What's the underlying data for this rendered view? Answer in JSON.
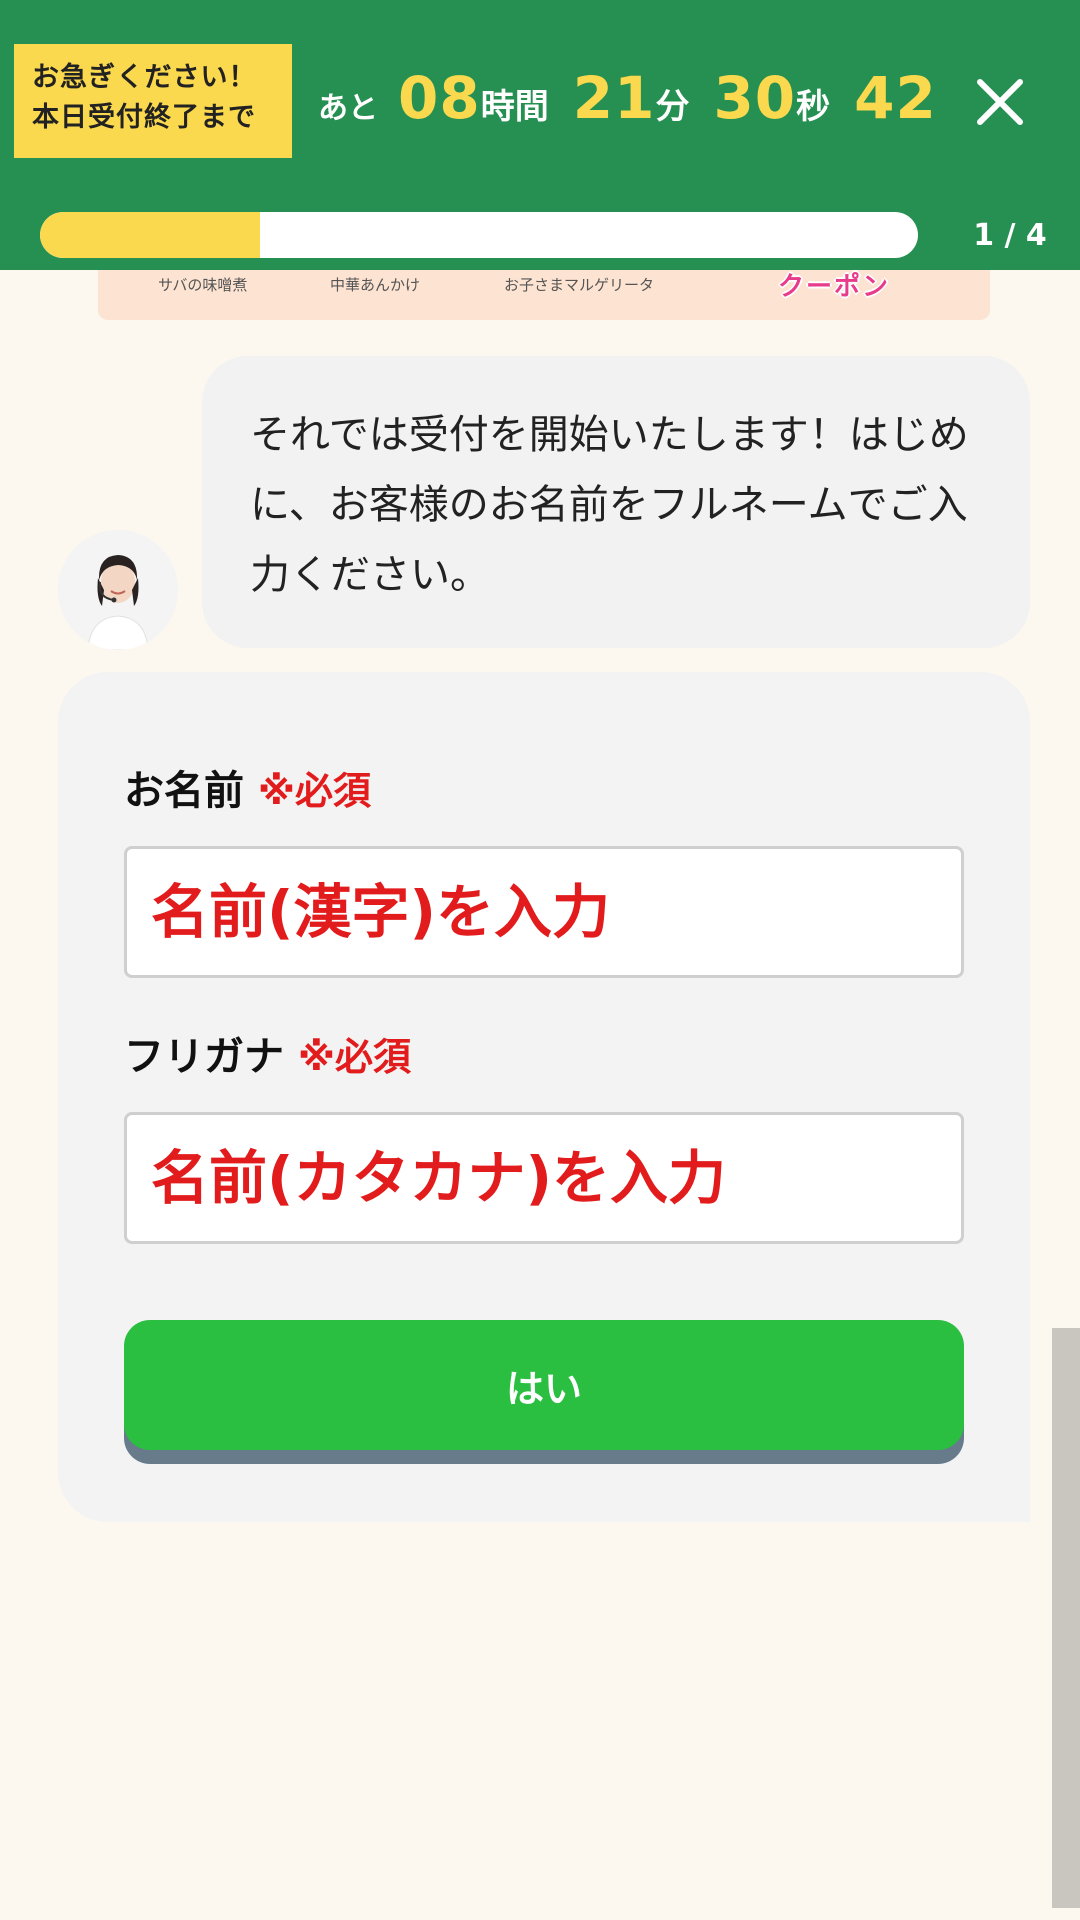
{
  "header": {
    "urgent_line1": "お急ぎください！",
    "urgent_line2": "本日受付終了まで",
    "countdown": {
      "prefix": "あと",
      "hours": "08",
      "hours_unit": "時間",
      "minutes": "21",
      "minutes_unit": "分",
      "seconds": "30",
      "seconds_unit": "秒",
      "centiseconds": "42"
    },
    "close_icon": "close-icon",
    "progress": {
      "fraction": 0.25,
      "label": "1 / 4"
    }
  },
  "banner": {
    "items": [
      "サバの味噌煮",
      "中華あんかけ",
      "お子さまマルゲリータ"
    ],
    "coupon_label": "クーポン"
  },
  "chat": {
    "avatar_icon": "operator-avatar",
    "message": "それでは受付を開始いたします！はじめに、お客様のお名前をフルネームでご入力ください。"
  },
  "form": {
    "name_label": "お名前",
    "name_required": "※必須",
    "name_placeholder": "名前(漢字)を入力",
    "name_value": "",
    "kana_label": "フリガナ",
    "kana_required": "※必須",
    "kana_placeholder": "名前(カタカナ)を入力",
    "kana_value": "",
    "submit_label": "はい"
  },
  "colors": {
    "header_bg": "#268f52",
    "accent_yellow": "#fbd94e",
    "required_red": "#e21c1c",
    "button_green": "#2bbf42",
    "page_bg": "#fcf7ef"
  }
}
